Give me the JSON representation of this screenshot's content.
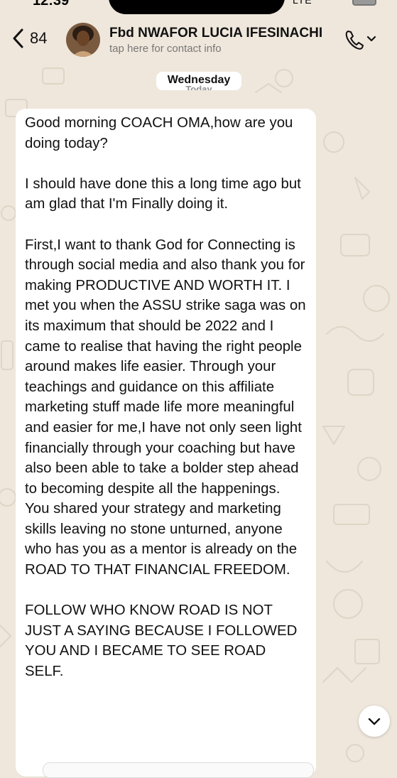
{
  "status": {
    "time": "12:39",
    "network": "LTE"
  },
  "header": {
    "back_count": "84",
    "contact_name": "Fbd NWAFOR LUCIA IFESINACHI",
    "contact_subtitle": "tap here for contact info",
    "icons": [
      "chevron-left-icon",
      "phone-icon",
      "chevron-down-icon"
    ]
  },
  "date_chip": {
    "label": "Wednesday",
    "ghost_label": "Today"
  },
  "message": {
    "paragraphs": [
      "Good morning COACH OMA,how are you doing today?",
      "I should have done this a long time ago but am glad that I'm Finally doing it.",
      "First,I want to thank God for Connecting is through social media and also thank you for making PRODUCTIVE AND WORTH IT. I met you when the ASSU strike saga was on its maximum that should be 2022 and I came to realise that having the right people around makes life easier. Through your teachings and guidance on this affiliate marketing stuff made life more meaningful and easier for me,I have not only seen light financially through your coaching but have also been able to take a bolder step ahead to becoming despite all the happenings.\nYou shared your strategy and marketing skills leaving no stone unturned, anyone who has you as a mentor is already on the ROAD TO THAT FINANCIAL FREEDOM.",
      "FOLLOW WHO KNOW ROAD IS NOT JUST A SAYING BECAUSE I FOLLOWED YOU AND I BECAME TO SEE ROAD SELF."
    ]
  },
  "colors": {
    "background": "#efe7dc",
    "bubble": "#ffffff",
    "text": "#111111",
    "subtitle": "#777777"
  }
}
